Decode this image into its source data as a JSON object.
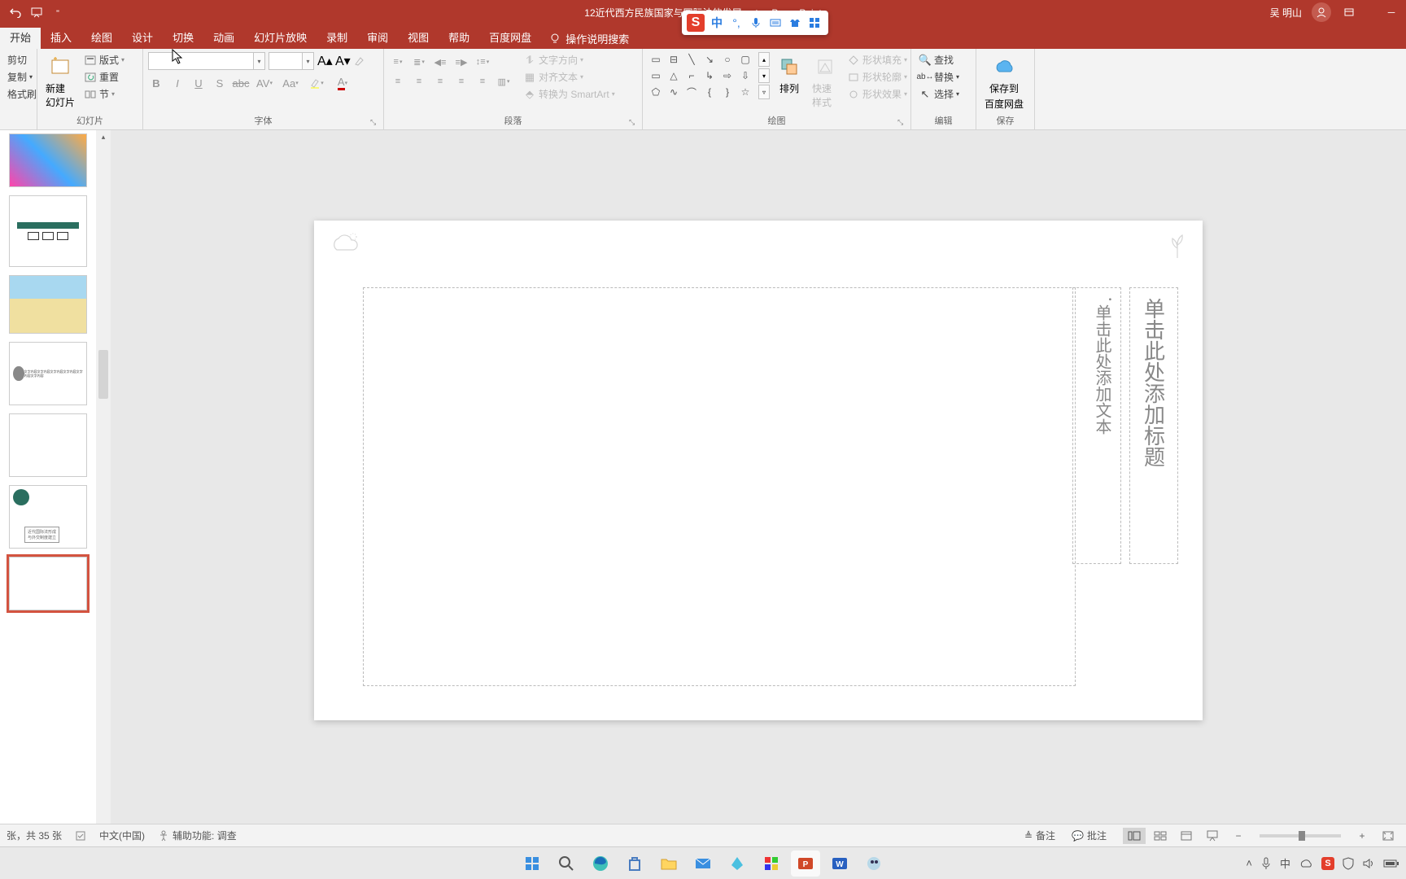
{
  "title_bar": {
    "doc_title": "12近代西方民族国家与国际法的发展.pptx - PowerPoint",
    "user_name": "吴 明山"
  },
  "ime": {
    "logo": "S",
    "lang": "中"
  },
  "tabs": {
    "items": [
      "开始",
      "插入",
      "绘图",
      "设计",
      "切换",
      "动画",
      "幻灯片放映",
      "录制",
      "审阅",
      "视图",
      "帮助",
      "百度网盘"
    ],
    "active": 0,
    "tell_me": "操作说明搜索"
  },
  "ribbon": {
    "clipboard": {
      "cut": "剪切",
      "copy": "复制",
      "painter": "格式刷",
      "label": ""
    },
    "slides": {
      "new_slide": "新建\n幻灯片",
      "layout": "版式",
      "reset": "重置",
      "section": "节",
      "label": "幻灯片"
    },
    "font": {
      "label": "字体"
    },
    "paragraph": {
      "text_dir": "文字方向",
      "align_text": "对齐文本",
      "smart": "转换为 SmartArt",
      "label": "段落"
    },
    "drawing": {
      "arrange": "排列",
      "quick": "快速样式",
      "fill": "形状填充",
      "outline": "形状轮廓",
      "effects": "形状效果",
      "label": "绘图"
    },
    "editing": {
      "find": "查找",
      "replace": "替换",
      "select": "选择",
      "label": "编辑"
    },
    "save_cloud": {
      "line1": "保存到",
      "line2": "百度网盘",
      "label": "保存"
    }
  },
  "slide": {
    "title_placeholder": "单击此处添加标题",
    "text_placeholder": "单击此处添加文本"
  },
  "status": {
    "slide_count": "张，共 35 张",
    "lang": "中文(中国)",
    "acc": "辅助功能: 调查",
    "notes": "备注",
    "comments": "批注"
  }
}
